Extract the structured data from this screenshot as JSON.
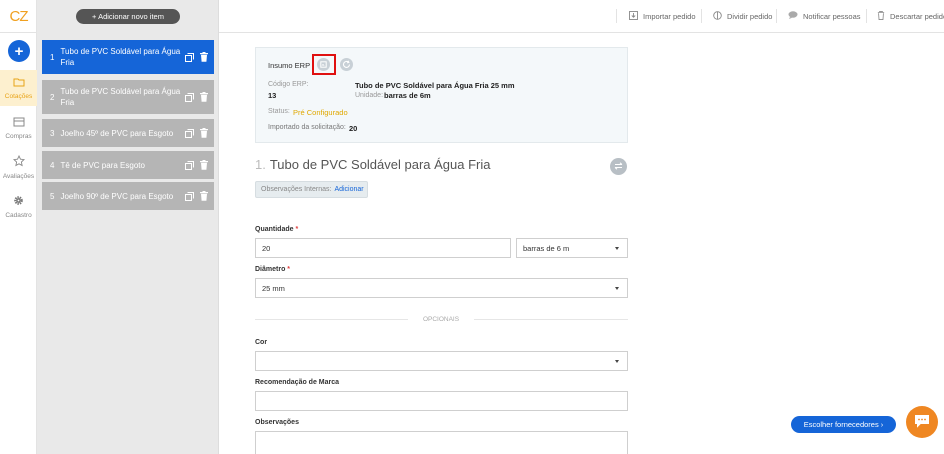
{
  "logo": "CZ",
  "rail": {
    "items": [
      {
        "label": "Cotações",
        "icon": "folder-icon"
      },
      {
        "label": "Compras",
        "icon": "card-icon"
      },
      {
        "label": "Avaliações",
        "icon": "star-icon"
      },
      {
        "label": "Cadastro",
        "icon": "gear-icon"
      }
    ]
  },
  "panel": {
    "add_label": "+ Adicionar novo item",
    "items": [
      {
        "num": "1",
        "name": "Tubo de PVC Soldável para Água Fria"
      },
      {
        "num": "2",
        "name": "Tubo de PVC Soldável para Água Fria"
      },
      {
        "num": "3",
        "name": "Joelho 45º de PVC para Esgoto"
      },
      {
        "num": "4",
        "name": "Tê de PVC para Esgoto"
      },
      {
        "num": "5",
        "name": "Joelho 90º de PVC para Esgoto"
      }
    ]
  },
  "topbar": {
    "import": "Importar pedido",
    "split": "Dividir pedido",
    "notify": "Notificar pessoas",
    "discard": "Descartar pedido"
  },
  "erp": {
    "label": "Insumo ERP",
    "code_key": "Código ERP:",
    "code_val": "13",
    "desc_val": "Tubo de PVC Soldável para Água Fria 25 mm",
    "unit_key": "Unidade:",
    "unit_val": "barras de 6m",
    "status_key": "Status:",
    "status_val": "Pré Configurado",
    "imported_key": "Importado da solicitação:",
    "imported_val": "20"
  },
  "item": {
    "num": "1.",
    "title": "Tubo de PVC Soldável para Água Fria",
    "obs_label": "Observações Internas:",
    "obs_link": "Adicionar"
  },
  "form": {
    "qty_label": "Quantidade",
    "qty_value": "20",
    "unit_value": "barras de 6 m",
    "diam_label": "Diâmetro",
    "diam_value": "25 mm",
    "optional_label": "OPCIONAIS",
    "color_label": "Cor",
    "color_value": "",
    "brand_label": "Recomendação de Marca",
    "brand_value": "",
    "obs_label": "Observações",
    "obs_value": "",
    "required_mark": "*"
  },
  "footer": {
    "choose_label": "Escolher fornecedores  ›"
  },
  "colors": {
    "primary": "#1565d8",
    "accent": "#e8a317",
    "chat": "#ef8722",
    "highlight": "#e01010"
  }
}
